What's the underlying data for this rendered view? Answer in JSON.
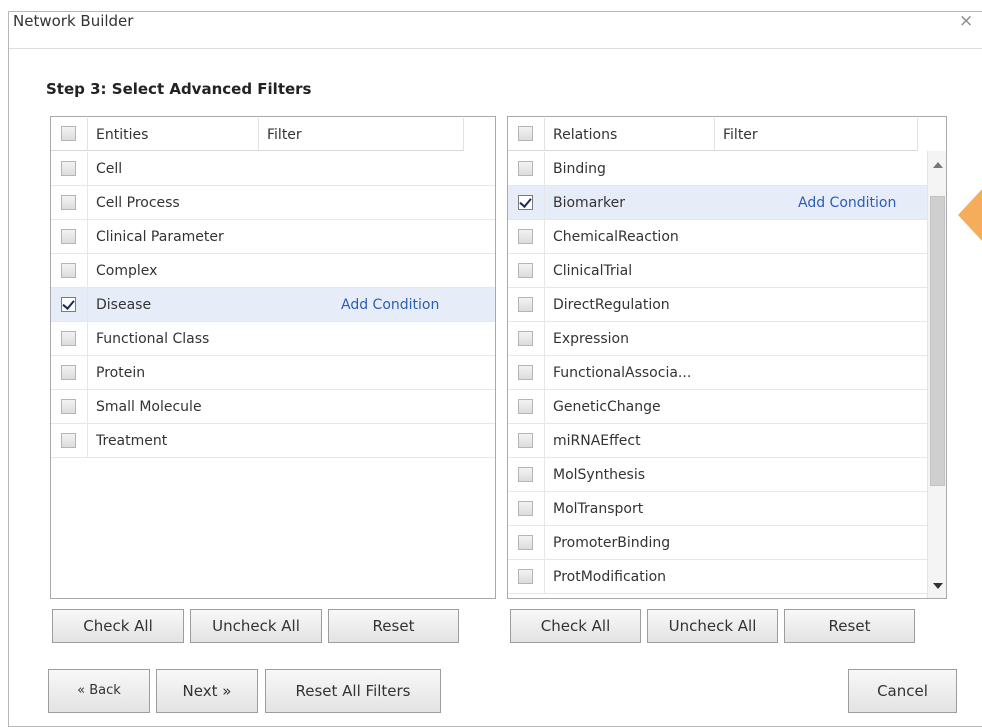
{
  "window": {
    "title": "Network Builder",
    "close_glyph": "×"
  },
  "step_title": "Step 3: Select Advanced Filters",
  "entities": {
    "header_name": "Entities",
    "header_filter": "Filter",
    "rows": [
      {
        "label": "Cell",
        "checked": false,
        "condition": ""
      },
      {
        "label": "Cell Process",
        "checked": false,
        "condition": ""
      },
      {
        "label": "Clinical Parameter",
        "checked": false,
        "condition": ""
      },
      {
        "label": "Complex",
        "checked": false,
        "condition": ""
      },
      {
        "label": "Disease",
        "checked": true,
        "condition": "Add Condition"
      },
      {
        "label": "Functional Class",
        "checked": false,
        "condition": ""
      },
      {
        "label": "Protein",
        "checked": false,
        "condition": ""
      },
      {
        "label": "Small Molecule",
        "checked": false,
        "condition": ""
      },
      {
        "label": "Treatment",
        "checked": false,
        "condition": ""
      }
    ],
    "buttons": {
      "check_all": "Check All",
      "uncheck_all": "Uncheck All",
      "reset": "Reset"
    }
  },
  "relations": {
    "header_name": "Relations",
    "header_filter": "Filter",
    "rows": [
      {
        "label": "Binding",
        "checked": false,
        "condition": ""
      },
      {
        "label": "Biomarker",
        "checked": true,
        "condition": "Add Condition"
      },
      {
        "label": "ChemicalReaction",
        "checked": false,
        "condition": ""
      },
      {
        "label": "ClinicalTrial",
        "checked": false,
        "condition": ""
      },
      {
        "label": "DirectRegulation",
        "checked": false,
        "condition": ""
      },
      {
        "label": "Expression",
        "checked": false,
        "condition": ""
      },
      {
        "label": "FunctionalAssocia...",
        "checked": false,
        "condition": ""
      },
      {
        "label": "GeneticChange",
        "checked": false,
        "condition": ""
      },
      {
        "label": "miRNAEffect",
        "checked": false,
        "condition": ""
      },
      {
        "label": "MolSynthesis",
        "checked": false,
        "condition": ""
      },
      {
        "label": "MolTransport",
        "checked": false,
        "condition": ""
      },
      {
        "label": "PromoterBinding",
        "checked": false,
        "condition": ""
      },
      {
        "label": "ProtModification",
        "checked": false,
        "condition": ""
      }
    ],
    "buttons": {
      "check_all": "Check All",
      "uncheck_all": "Uncheck All",
      "reset": "Reset"
    }
  },
  "footer": {
    "back": "« Back",
    "next": "Next »",
    "reset_all": "Reset All Filters",
    "cancel": "Cancel"
  },
  "colors": {
    "selected_row": "#e7edf8",
    "link": "#2c5db5",
    "callout": "#f5ad5c"
  }
}
